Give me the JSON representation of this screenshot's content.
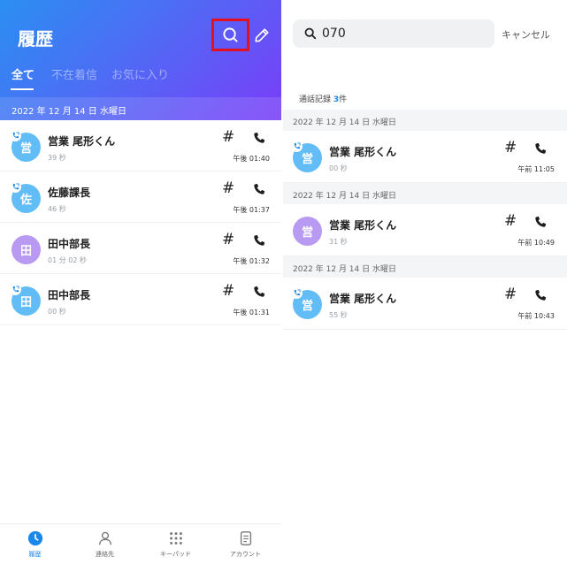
{
  "left": {
    "title": "履歴",
    "tabs": [
      {
        "label": "全て",
        "active": true
      },
      {
        "label": "不在着信",
        "active": false
      },
      {
        "label": "お気に入り",
        "active": false
      }
    ],
    "date_header": "2022 年 12 月 14 日 水曜日",
    "calls": [
      {
        "avatar": "営",
        "name": "営業 尾形くん",
        "duration": "39 秒",
        "time": "午後 01:40",
        "hash": "#"
      },
      {
        "avatar": "佐",
        "name": "佐藤課長",
        "duration": "46 秒",
        "time": "午後 01:37",
        "hash": "#"
      },
      {
        "avatar": "田",
        "name": "田中部長",
        "duration": "01 分 02 秒",
        "time": "午後 01:32",
        "hash": "#"
      },
      {
        "avatar": "田",
        "name": "田中部長",
        "duration": "00 秒",
        "time": "午後 01:31",
        "hash": "#"
      }
    ],
    "nav": [
      {
        "label": "履歴",
        "icon": "history-clock-icon",
        "active": true
      },
      {
        "label": "連絡先",
        "icon": "contacts-person-icon",
        "active": false
      },
      {
        "label": "キーパッド",
        "icon": "keypad-icon",
        "active": false
      },
      {
        "label": "アカウント",
        "icon": "account-document-icon",
        "active": false
      }
    ]
  },
  "right": {
    "search_value": "070",
    "cancel_label": "キャンセル",
    "results_prefix": "通話記録",
    "results_count": "3",
    "results_suffix": "件",
    "groups": [
      {
        "date": "2022 年 12 月 14 日 水曜日",
        "avatar": "営",
        "name": "営業 尾形くん",
        "duration": "00 秒",
        "time": "午前 11:05",
        "hash": "#"
      },
      {
        "date": "2022 年 12 月 14 日 水曜日",
        "avatar": "営",
        "name": "営業 尾形くん",
        "duration": "31 秒",
        "time": "午前 10:49",
        "hash": "#"
      },
      {
        "date": "2022 年 12 月 14 日 水曜日",
        "avatar": "営",
        "name": "営業 尾形くん",
        "duration": "55 秒",
        "time": "午前 10:43",
        "hash": "#"
      }
    ]
  },
  "colors": {
    "accent": "#1a88e8",
    "highlight_border": "#e3101e",
    "avatar_blue": "#62bdf6",
    "avatar_purple": "#b89af2",
    "gradient_start": "#2a8ff2",
    "gradient_end": "#7a3df8"
  }
}
